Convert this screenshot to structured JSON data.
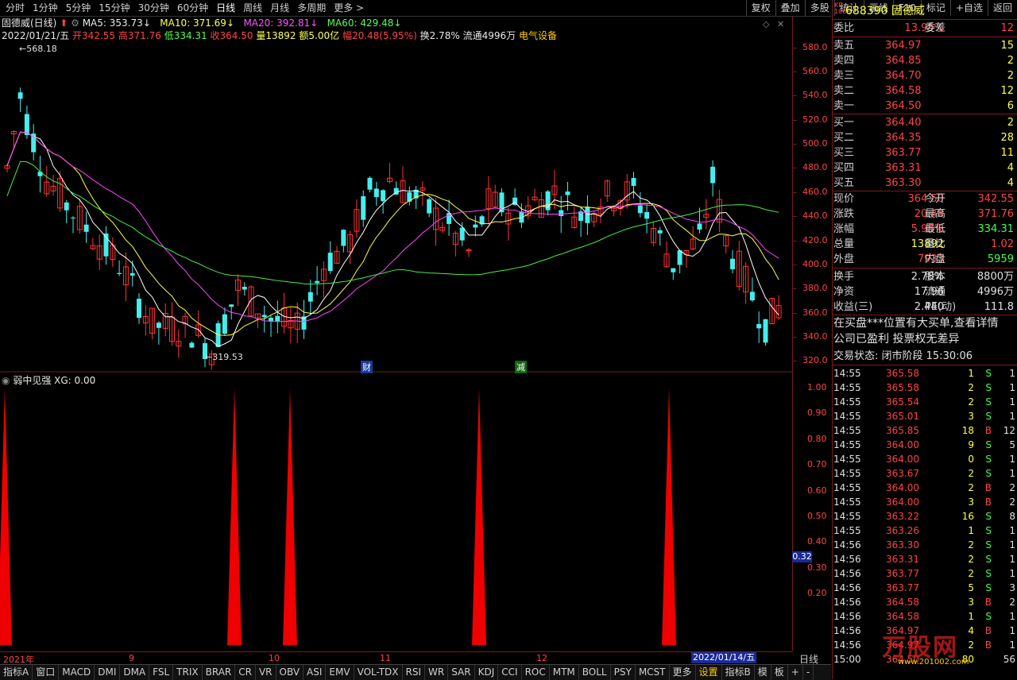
{
  "toolbar": {
    "periods": [
      "分时",
      "1分钟",
      "5分钟",
      "15分钟",
      "30分钟",
      "60分钟",
      "日线",
      "周线",
      "月线",
      "多周期",
      "更多 >"
    ],
    "tools": [
      "复权",
      "叠加",
      "多股",
      "统计",
      "画线",
      "F10",
      "标记",
      "+自选",
      "返回"
    ]
  },
  "info": {
    "title": "固德威(日线)",
    "ma5": "MA5: 353.73",
    "ma10": "MA10: 371.69",
    "ma20": "MA20: 392.81",
    "ma60": "MA60: 429.48",
    "date": "2022/01/21/五",
    "open": "开342.55",
    "high": "高371.76",
    "low": "低334.31",
    "close": "收364.50",
    "vol": "量13892",
    "amount": "额5.00亿",
    "change": "幅20.48(5.95%)",
    "turnover": "换2.78%",
    "float": "流通4996万",
    "industry": "电气设备"
  },
  "chart_data": {
    "type": "candlestick",
    "y_ticks": [
      "580.0",
      "560.0",
      "540.0",
      "520.0",
      "500.0",
      "480.0",
      "460.0",
      "440.0",
      "420.0",
      "400.0",
      "380.0",
      "360.0",
      "340.0",
      "320.0"
    ],
    "ylim": [
      315,
      585
    ],
    "high_label": "568.18",
    "low_label": "319.53",
    "markers": [
      "财",
      "减"
    ],
    "x_ticks": [
      "2021年",
      "9",
      "10",
      "11",
      "12"
    ],
    "x_date": "2022/01/14/五",
    "x_mode": "日线",
    "indicator": {
      "title": "弱中见强",
      "value_label": "XG: 0.00",
      "y_ticks": [
        "1.00",
        "0.90",
        "0.80",
        "0.70",
        "0.60",
        "0.50",
        "0.40",
        "0.30",
        "0.20"
      ],
      "current": "0.32",
      "spikes": 6
    }
  },
  "bottom_tabs": [
    "指标A",
    "窗口",
    "MACD",
    "DMI",
    "DMA",
    "FSL",
    "TRIX",
    "BRAR",
    "CR",
    "VR",
    "OBV",
    "ASI",
    "EMV",
    "VOL-TDX",
    "RSI",
    "WR",
    "SAR",
    "KDJ",
    "CCI",
    "ROC",
    "MTM",
    "BOLL",
    "PSY",
    "MCST",
    "更多",
    "设置",
    "指标B",
    "模",
    "板",
    "+",
    "-"
  ],
  "panel": {
    "badge": "KR\n1000",
    "code": "688390",
    "name": "固德威",
    "weibi_label": "委比",
    "weibi": "13.95%",
    "weicha_label": "委差",
    "weicha": "12",
    "asks": [
      {
        "label": "卖五",
        "price": "364.97",
        "vol": "15"
      },
      {
        "label": "卖四",
        "price": "364.85",
        "vol": "2"
      },
      {
        "label": "卖三",
        "price": "364.70",
        "vol": "2"
      },
      {
        "label": "卖二",
        "price": "364.58",
        "vol": "12"
      },
      {
        "label": "卖一",
        "price": "364.50",
        "vol": "6"
      }
    ],
    "bids": [
      {
        "label": "买一",
        "price": "364.40",
        "vol": "2"
      },
      {
        "label": "买二",
        "price": "364.35",
        "vol": "28"
      },
      {
        "label": "买三",
        "price": "363.77",
        "vol": "11"
      },
      {
        "label": "买四",
        "price": "363.31",
        "vol": "4"
      },
      {
        "label": "买五",
        "price": "363.30",
        "vol": "4"
      }
    ],
    "stats": [
      {
        "l1": "现价",
        "v1": "364.50",
        "l2": "今开",
        "v2": "342.55",
        "c1": "red",
        "c2": "red"
      },
      {
        "l1": "涨跌",
        "v1": "20.48",
        "l2": "最高",
        "v2": "371.76",
        "c1": "red",
        "c2": "red"
      },
      {
        "l1": "涨幅",
        "v1": "5.95%",
        "l2": "最低",
        "v2": "334.31",
        "c1": "red",
        "c2": "grn"
      },
      {
        "l1": "总量",
        "v1": "13892",
        "l2": "量比",
        "v2": "1.02",
        "c1": "yel",
        "c2": "red"
      },
      {
        "l1": "外盘",
        "v1": "7933",
        "l2": "内盘",
        "v2": "5959",
        "c1": "red",
        "c2": "grn"
      }
    ],
    "stats2": [
      {
        "l1": "换手",
        "v1": "2.78%",
        "l2": "股本",
        "v2": "8800万"
      },
      {
        "l1": "净资",
        "v1": "17.96",
        "l2": "流通",
        "v2": "4996万"
      },
      {
        "l1": "收益(三)",
        "v1": "2.440",
        "l2": "PE(动)",
        "v2": "111.8"
      }
    ],
    "notes": [
      "在买盘***位置有大买单,查看详情",
      "公司已盈利 投票权无差异"
    ],
    "status": "交易状态: 闭市阶段 15:30:06",
    "ticks": [
      {
        "t": "14:55",
        "p": "365.58",
        "v": "1",
        "s": "S",
        "n": "1"
      },
      {
        "t": "14:55",
        "p": "365.58",
        "v": "2",
        "s": "S",
        "n": "1"
      },
      {
        "t": "14:55",
        "p": "365.54",
        "v": "2",
        "s": "S",
        "n": "1"
      },
      {
        "t": "14:55",
        "p": "365.01",
        "v": "3",
        "s": "S",
        "n": "1"
      },
      {
        "t": "14:55",
        "p": "365.85",
        "v": "18",
        "s": "B",
        "n": "12"
      },
      {
        "t": "14:55",
        "p": "364.00",
        "v": "9",
        "s": "S",
        "n": "5"
      },
      {
        "t": "14:55",
        "p": "364.00",
        "v": "0",
        "s": "S",
        "n": "1"
      },
      {
        "t": "14:55",
        "p": "363.67",
        "v": "2",
        "s": "S",
        "n": "1"
      },
      {
        "t": "14:55",
        "p": "364.00",
        "v": "2",
        "s": "B",
        "n": "2"
      },
      {
        "t": "14:55",
        "p": "364.00",
        "v": "3",
        "s": "B",
        "n": "2"
      },
      {
        "t": "14:55",
        "p": "363.22",
        "v": "16",
        "s": "S",
        "n": "8"
      },
      {
        "t": "14:55",
        "p": "363.26",
        "v": "1",
        "s": "S",
        "n": "1"
      },
      {
        "t": "14:56",
        "p": "363.30",
        "v": "2",
        "s": "S",
        "n": "1"
      },
      {
        "t": "14:56",
        "p": "363.31",
        "v": "2",
        "s": "S",
        "n": "1"
      },
      {
        "t": "14:56",
        "p": "363.77",
        "v": "2",
        "s": "S",
        "n": "1"
      },
      {
        "t": "14:56",
        "p": "363.77",
        "v": "5",
        "s": "S",
        "n": "3"
      },
      {
        "t": "14:56",
        "p": "364.58",
        "v": "3",
        "s": "B",
        "n": "2"
      },
      {
        "t": "14:56",
        "p": "364.58",
        "v": "1",
        "s": "S",
        "n": "1"
      },
      {
        "t": "14:56",
        "p": "364.97",
        "v": "4",
        "s": "B",
        "n": "1"
      },
      {
        "t": "14:56",
        "p": "364.97",
        "v": "2",
        "s": "B",
        "n": "1"
      },
      {
        "t": "15:00",
        "p": "364.50",
        "v": "80",
        "s": "",
        "n": "56"
      }
    ],
    "watermark": "万股网",
    "watermark_url": "www.201002.com"
  }
}
